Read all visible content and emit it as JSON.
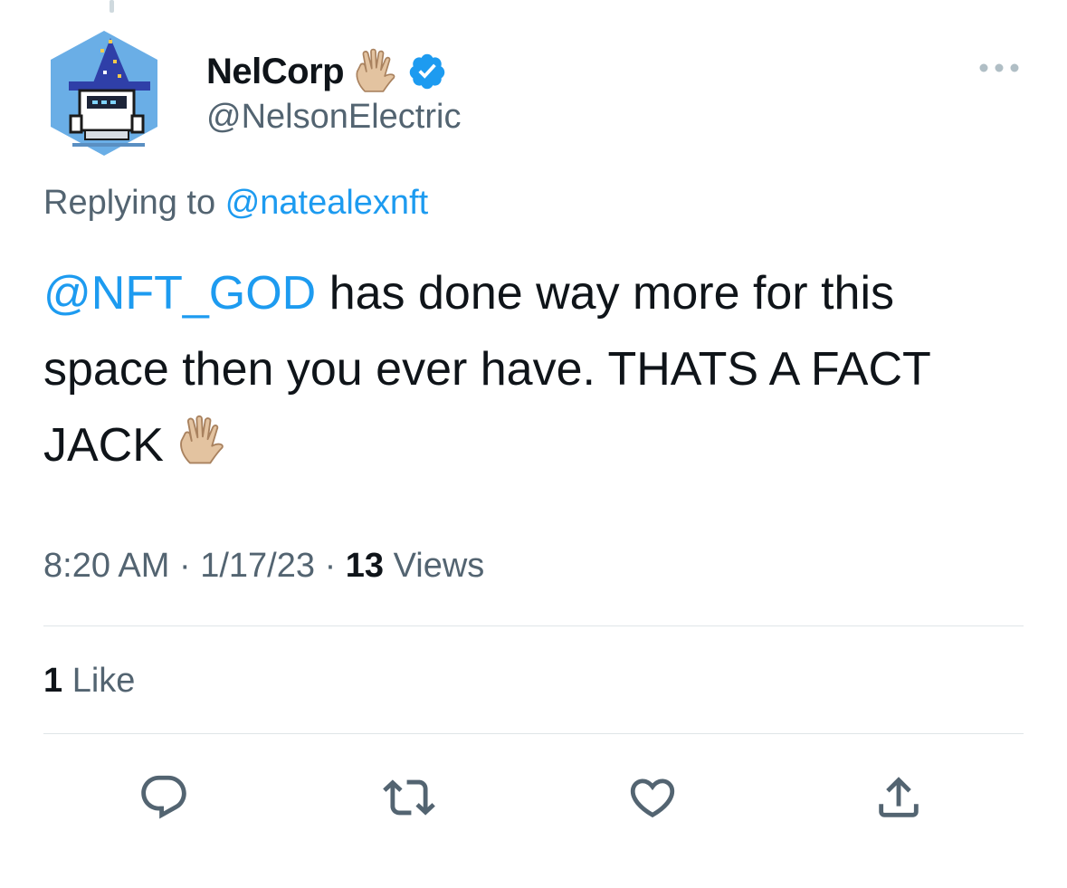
{
  "tweet": {
    "author": {
      "display_name": "NelCorp",
      "handle": "@NelsonElectric",
      "avatar_icon": "wizard-robot-avatar",
      "name_emoji": "vulcan-salute-emoji",
      "verified_icon": "verified-badge-icon",
      "verified_color": "#1d9bf0"
    },
    "more_icon": "more-options-icon",
    "reply": {
      "prefix": "Replying to",
      "mention": "@natealexnft"
    },
    "text": {
      "mention": "@NFT_GOD",
      "body": "has done way more for this space then you ever have. THATS A FACT JACK",
      "trailing_emoji": "vulcan-salute-emoji"
    },
    "meta": {
      "time": "8:20 AM",
      "separator": "·",
      "date": "1/17/23",
      "views_count": "13",
      "views_label": "Views"
    },
    "engagement": {
      "likes_count": "1",
      "likes_label": "Like"
    },
    "actions": [
      {
        "icon": "reply-icon"
      },
      {
        "icon": "retweet-icon"
      },
      {
        "icon": "like-icon"
      },
      {
        "icon": "share-icon"
      }
    ],
    "colors": {
      "link": "#1d9bf0",
      "secondary_text": "#536471",
      "primary_text": "#0f1419"
    }
  }
}
